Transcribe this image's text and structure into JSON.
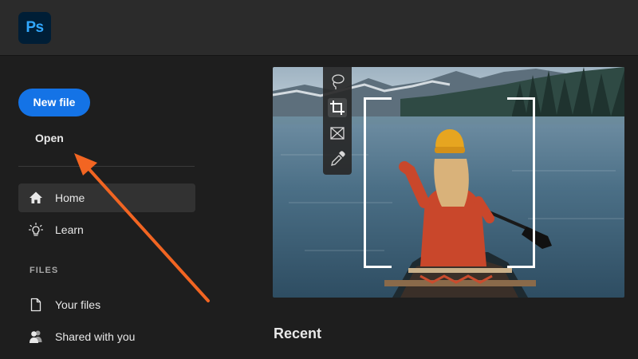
{
  "app": {
    "logo_text": "Ps"
  },
  "sidebar": {
    "new_file_label": "New file",
    "open_label": "Open",
    "nav": [
      {
        "label": "Home",
        "icon": "home-icon",
        "active": true
      },
      {
        "label": "Learn",
        "icon": "lightbulb-icon",
        "active": false
      }
    ],
    "files_header": "FILES",
    "files": [
      {
        "label": "Your files",
        "icon": "document-icon"
      },
      {
        "label": "Shared with you",
        "icon": "people-icon"
      }
    ]
  },
  "toolbar": {
    "tools": [
      "lasso-icon",
      "crop-icon",
      "frame-icon",
      "eyedropper-icon"
    ],
    "selected": "crop-icon"
  },
  "main": {
    "recent_heading": "Recent"
  },
  "annotation": {
    "color": "#f26522"
  },
  "colors": {
    "accent": "#1473e6",
    "logo_bg": "#001e36",
    "logo_text": "#31a8ff"
  }
}
